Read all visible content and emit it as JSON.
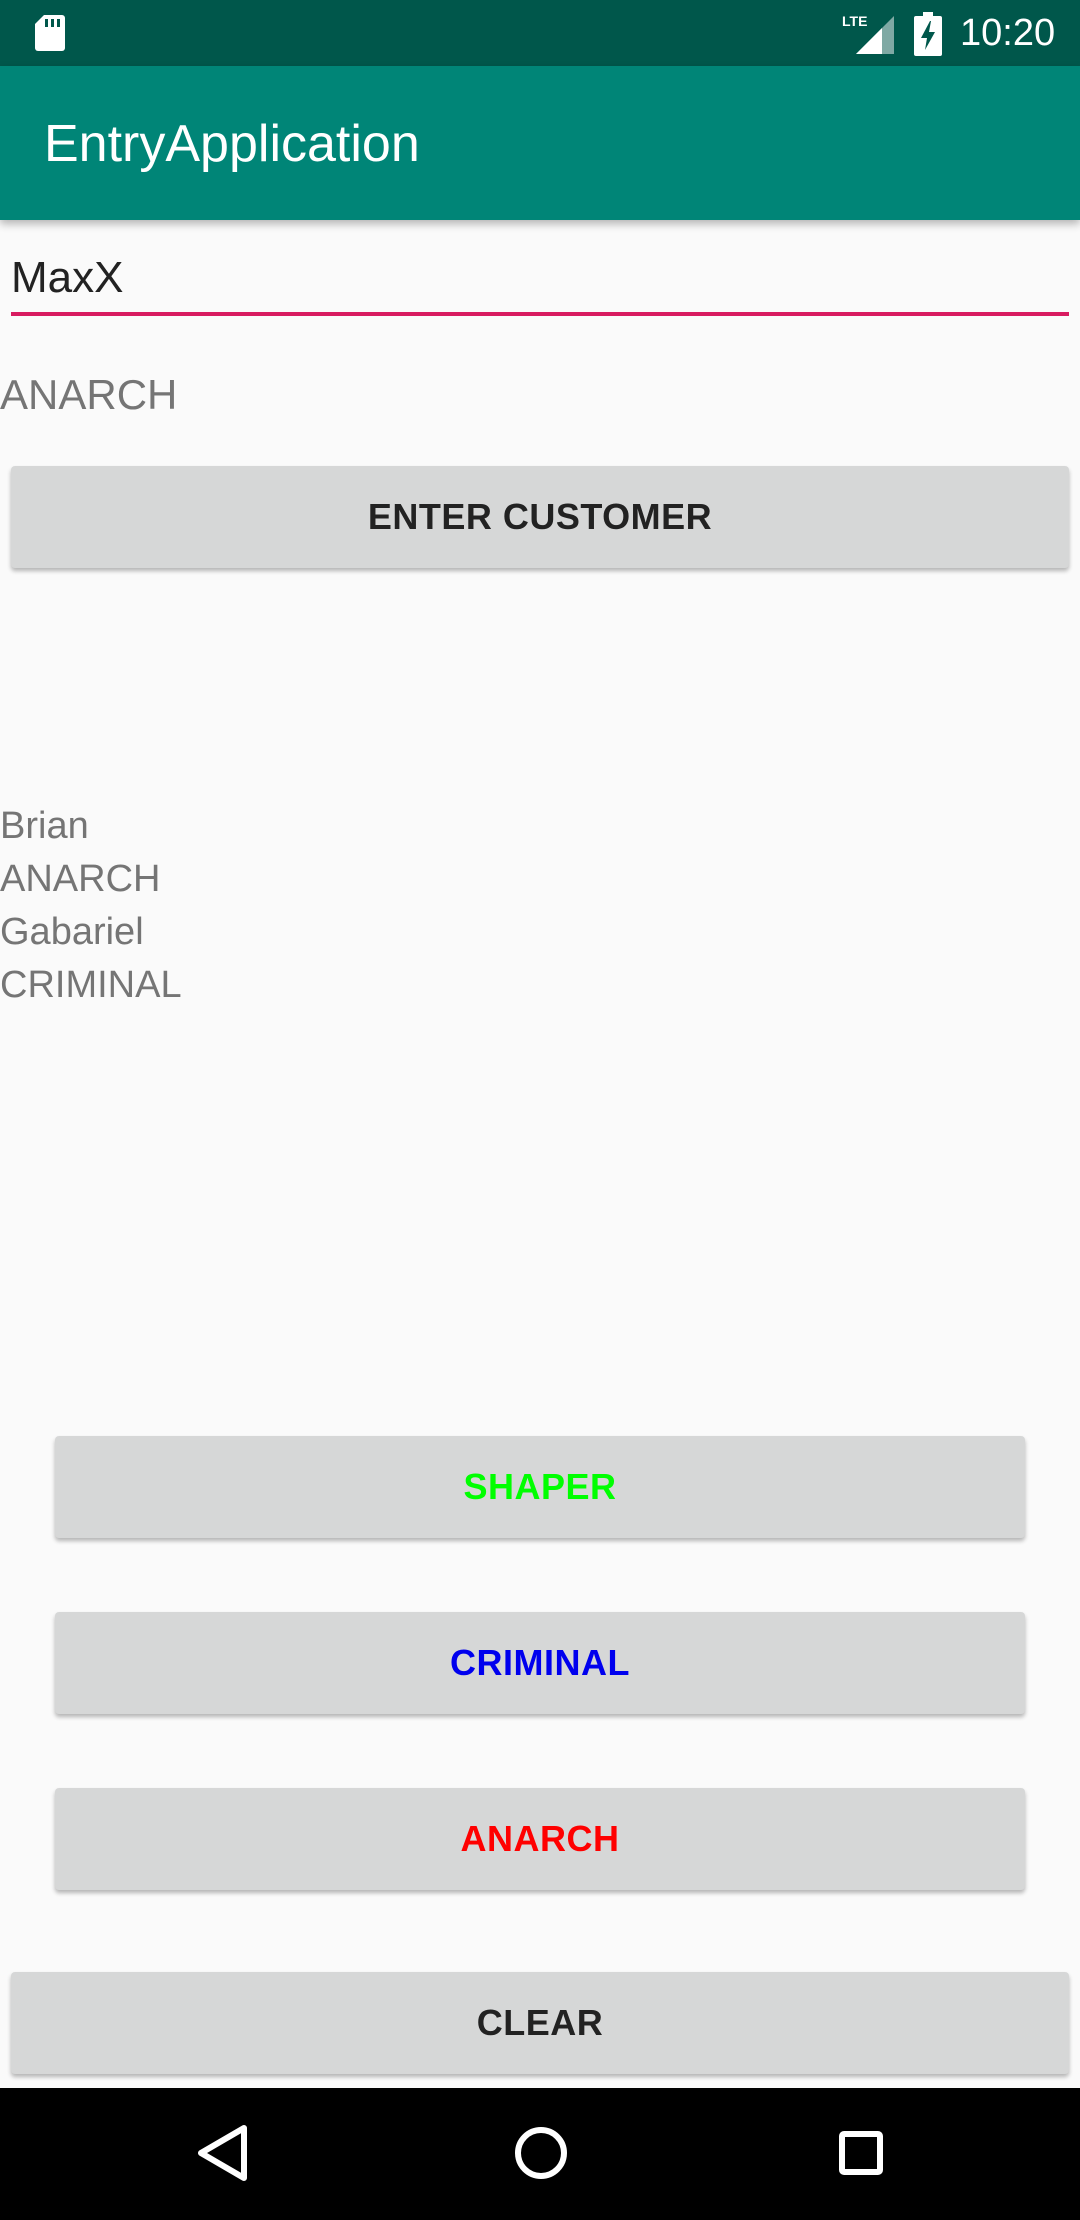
{
  "status_bar": {
    "time": "10:20",
    "network_label": "LTE",
    "icons": [
      "sd-card-icon",
      "lte-signal-icon",
      "battery-charging-icon"
    ]
  },
  "app_bar": {
    "title": "EntryApplication",
    "color": "#008577",
    "status_color": "#00574b"
  },
  "form": {
    "name_value": "MaxX",
    "underline_color": "#d81b60",
    "selected_type": "ANARCH",
    "enter_label": "ENTER CUSTOMER"
  },
  "customers": {
    "lines": [
      "Brian",
      "ANARCH",
      "Gabariel",
      "CRIMINAL"
    ]
  },
  "type_buttons": {
    "shaper": {
      "label": "SHAPER",
      "color": "#00ff00"
    },
    "criminal": {
      "label": "CRIMINAL",
      "color": "#0000ee"
    },
    "anarch": {
      "label": "ANARCH",
      "color": "#ff0000"
    }
  },
  "clear_label": "CLEAR",
  "nav_bar": {
    "icons": [
      "back-icon",
      "home-icon",
      "recents-icon"
    ]
  }
}
